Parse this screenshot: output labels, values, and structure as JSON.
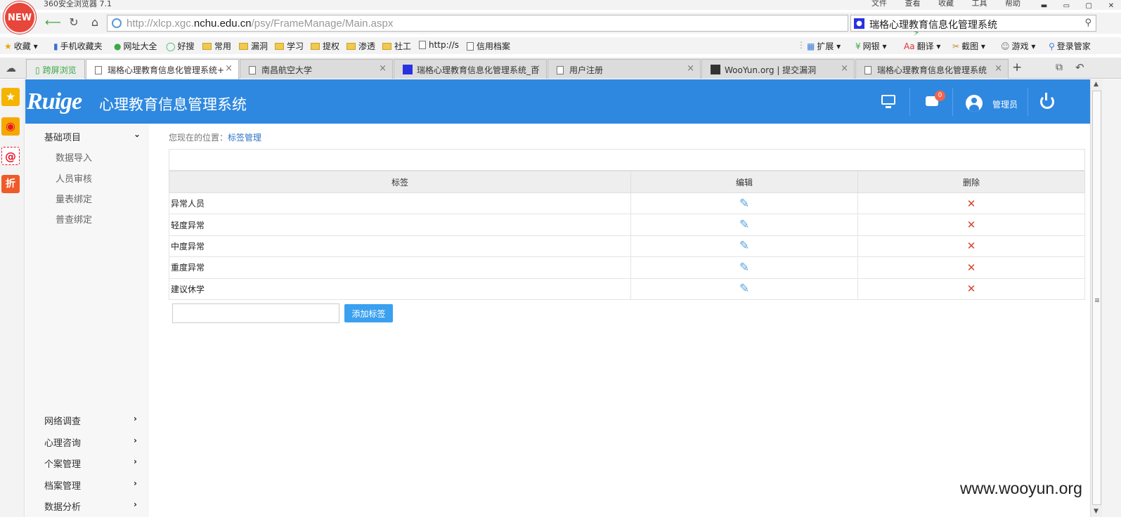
{
  "browser": {
    "logo_text": "NEW",
    "name": "360安全浏览器 7.1",
    "menu": [
      "文件",
      "查看",
      "收藏",
      "工具",
      "帮助"
    ],
    "window_controls": [
      "▬",
      "▭",
      "▢",
      "✕"
    ],
    "address_prefix": "http://xlcp.xgc.",
    "address_domain": "nchu.edu.cn",
    "address_path": "/psy/FrameManage/Main.aspx",
    "search_text": "瑞格心理教育信息化管理系统",
    "bookmarks": [
      {
        "label": "收藏",
        "icon": "star-icon"
      },
      {
        "label": "手机收藏夹",
        "icon": "phone-icon"
      },
      {
        "label": "网址大全",
        "icon": "globe-icon"
      },
      {
        "label": "好搜",
        "icon": "search-icon"
      },
      {
        "label": "常用",
        "icon": "folder-icon"
      },
      {
        "label": "漏洞",
        "icon": "folder-icon"
      },
      {
        "label": "学习",
        "icon": "folder-icon"
      },
      {
        "label": "提权",
        "icon": "folder-icon"
      },
      {
        "label": "渗透",
        "icon": "folder-icon"
      },
      {
        "label": "社工",
        "icon": "folder-icon"
      },
      {
        "label": "http://s",
        "icon": "page-icon"
      },
      {
        "label": "信用档案",
        "icon": "page-icon"
      }
    ],
    "toolbar_right": [
      "扩展",
      "网银",
      "翻译",
      "截图",
      "游戏",
      "登录管家"
    ],
    "tabs": [
      {
        "label": "跨屏浏览",
        "special": true
      },
      {
        "label": "瑞格心理教育信息化管理系统+",
        "active": true
      },
      {
        "label": "南昌航空大学"
      },
      {
        "label": "瑞格心理教育信息化管理系统_百"
      },
      {
        "label": "用户注册"
      },
      {
        "label": "WooYun.org | 提交漏洞"
      },
      {
        "label": "瑞格心理教育信息化管理系统"
      }
    ],
    "new_tab": "+"
  },
  "side_strip": [
    {
      "icon": "favorites-star-icon",
      "color": "#f5b400",
      "glyph": "★"
    },
    {
      "icon": "weibo-icon",
      "color": "#e6162d",
      "glyph": "◉"
    },
    {
      "icon": "mail-icon",
      "color": "#ffffff",
      "glyph": "@"
    },
    {
      "icon": "discount-icon",
      "color": "#f05a28",
      "glyph": "折"
    }
  ],
  "app": {
    "logo": "Ruige",
    "title": "心理教育信息管理系统",
    "message_count": "0",
    "user": "管理员"
  },
  "sidebar": {
    "sections": [
      {
        "label": "基础项目",
        "expanded": true,
        "items": [
          "数据导入",
          "人员审核",
          "量表绑定",
          "普查绑定"
        ]
      },
      {
        "label": "网络调查"
      },
      {
        "label": "心理咨询"
      },
      {
        "label": "个案管理"
      },
      {
        "label": "档案管理"
      },
      {
        "label": "数据分析"
      }
    ]
  },
  "main": {
    "breadcrumb_prefix": "您现在的位置：",
    "breadcrumb_current": "标签管理",
    "table": {
      "headers": [
        "标签",
        "编辑",
        "删除"
      ],
      "rows": [
        "异常人员",
        "轻度异常",
        "中度异常",
        "重度异常",
        "建议休学"
      ]
    },
    "new_tag_value": "",
    "add_button": "添加标签"
  },
  "watermark": "www.wooyun.org"
}
